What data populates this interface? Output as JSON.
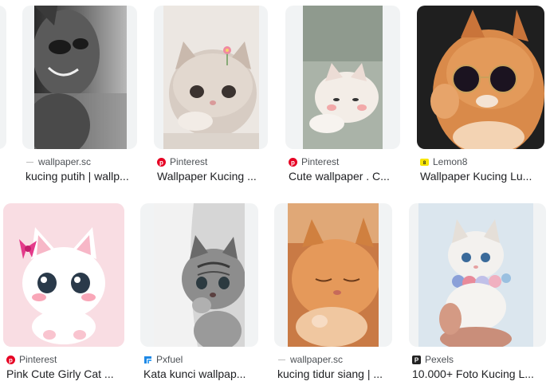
{
  "results": [
    {
      "source": "wallpaper.sc",
      "title": "kucing putih | wallp...",
      "favicon": "wallpaper-sc-favicon"
    },
    {
      "source": "Pinterest",
      "title": "Wallpaper Kucing ...",
      "favicon": "pinterest-favicon",
      "favicon_color": "#e60023"
    },
    {
      "source": "Pinterest",
      "title": "Cute wallpaper . C...",
      "favicon": "pinterest-favicon",
      "favicon_color": "#e60023"
    },
    {
      "source": "Lemon8",
      "title": "Wallpaper Kucing Lu...",
      "favicon": "lemon8-favicon",
      "favicon_color": "#f7e500"
    },
    {
      "source": "Pinterest",
      "title": "Pink Cute Girly Cat ...",
      "favicon": "pinterest-favicon",
      "favicon_color": "#e60023"
    },
    {
      "source": "Pxfuel",
      "title": "Kata kunci wallpap...",
      "favicon": "pxfuel-favicon",
      "favicon_color": "#1e88e5"
    },
    {
      "source": "wallpaper.sc",
      "title": "kucing tidur siang | ...",
      "favicon": "wallpaper-sc-favicon"
    },
    {
      "source": "Pexels",
      "title": "10.000+ Foto Kucing L...",
      "favicon": "pexels-favicon",
      "favicon_color": "#05a081"
    }
  ]
}
